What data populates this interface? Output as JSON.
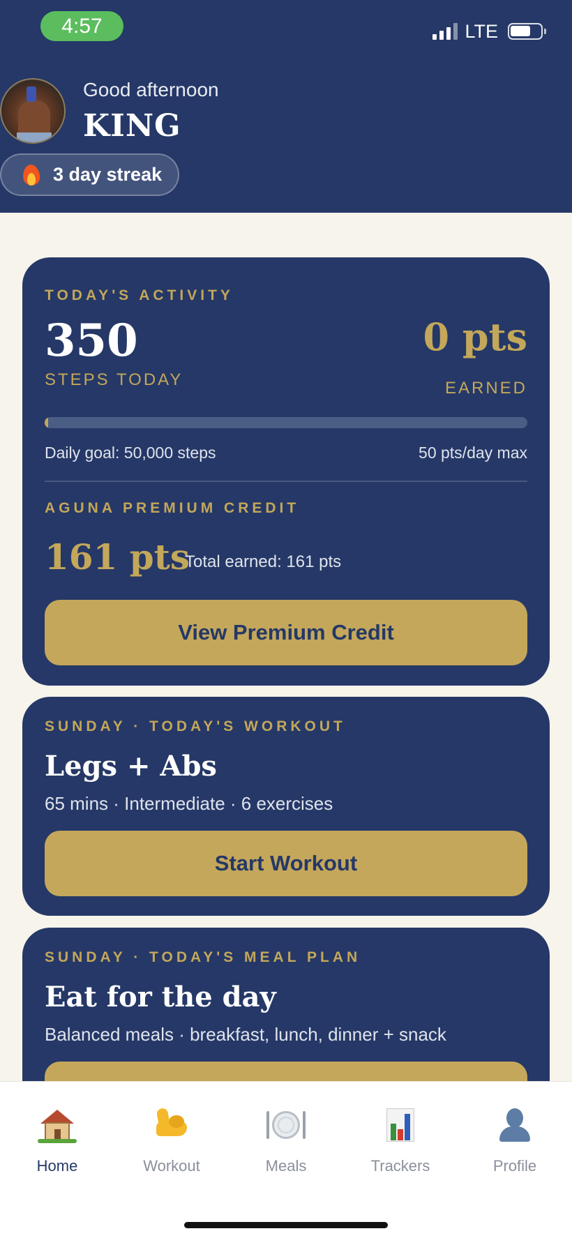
{
  "status_bar": {
    "time": "4:57",
    "network": "LTE"
  },
  "header": {
    "greeting": "Good afternoon",
    "username": "KING",
    "streak": "3 day streak"
  },
  "activity": {
    "eyebrow": "TODAY'S ACTIVITY",
    "steps": "350",
    "steps_label": "STEPS TODAY",
    "points": "0 pts",
    "points_label": "EARNED",
    "goal_text": "Daily goal: 50,000 steps",
    "max_text": "50 pts/day max",
    "progress_fraction": 0.007,
    "credit_eyebrow": "AGUNA PREMIUM CREDIT",
    "credit_value": "161 pts",
    "credit_total": "Total earned: 161 pts",
    "button": "View Premium Credit"
  },
  "workout": {
    "eyebrow": "SUNDAY · TODAY'S WORKOUT",
    "title": "Legs + Abs",
    "subtitle": "65 mins · Intermediate · 6 exercises",
    "button": "Start Workout"
  },
  "meal": {
    "eyebrow": "SUNDAY · TODAY'S MEAL PLAN",
    "title": "Eat for the day",
    "subtitle": "Balanced meals · breakfast, lunch, dinner + snack"
  },
  "nav": {
    "items": [
      {
        "label": "Home",
        "icon": "house-icon",
        "active": true
      },
      {
        "label": "Workout",
        "icon": "flexed-arm-icon",
        "active": false
      },
      {
        "label": "Meals",
        "icon": "plate-icon",
        "active": false
      },
      {
        "label": "Trackers",
        "icon": "bar-chart-icon",
        "active": false
      },
      {
        "label": "Profile",
        "icon": "person-icon",
        "active": false
      }
    ]
  },
  "colors": {
    "navy": "#253867",
    "gold": "#c4a75a",
    "cream": "#f7f4ec",
    "status_green": "#5cbd5e"
  }
}
